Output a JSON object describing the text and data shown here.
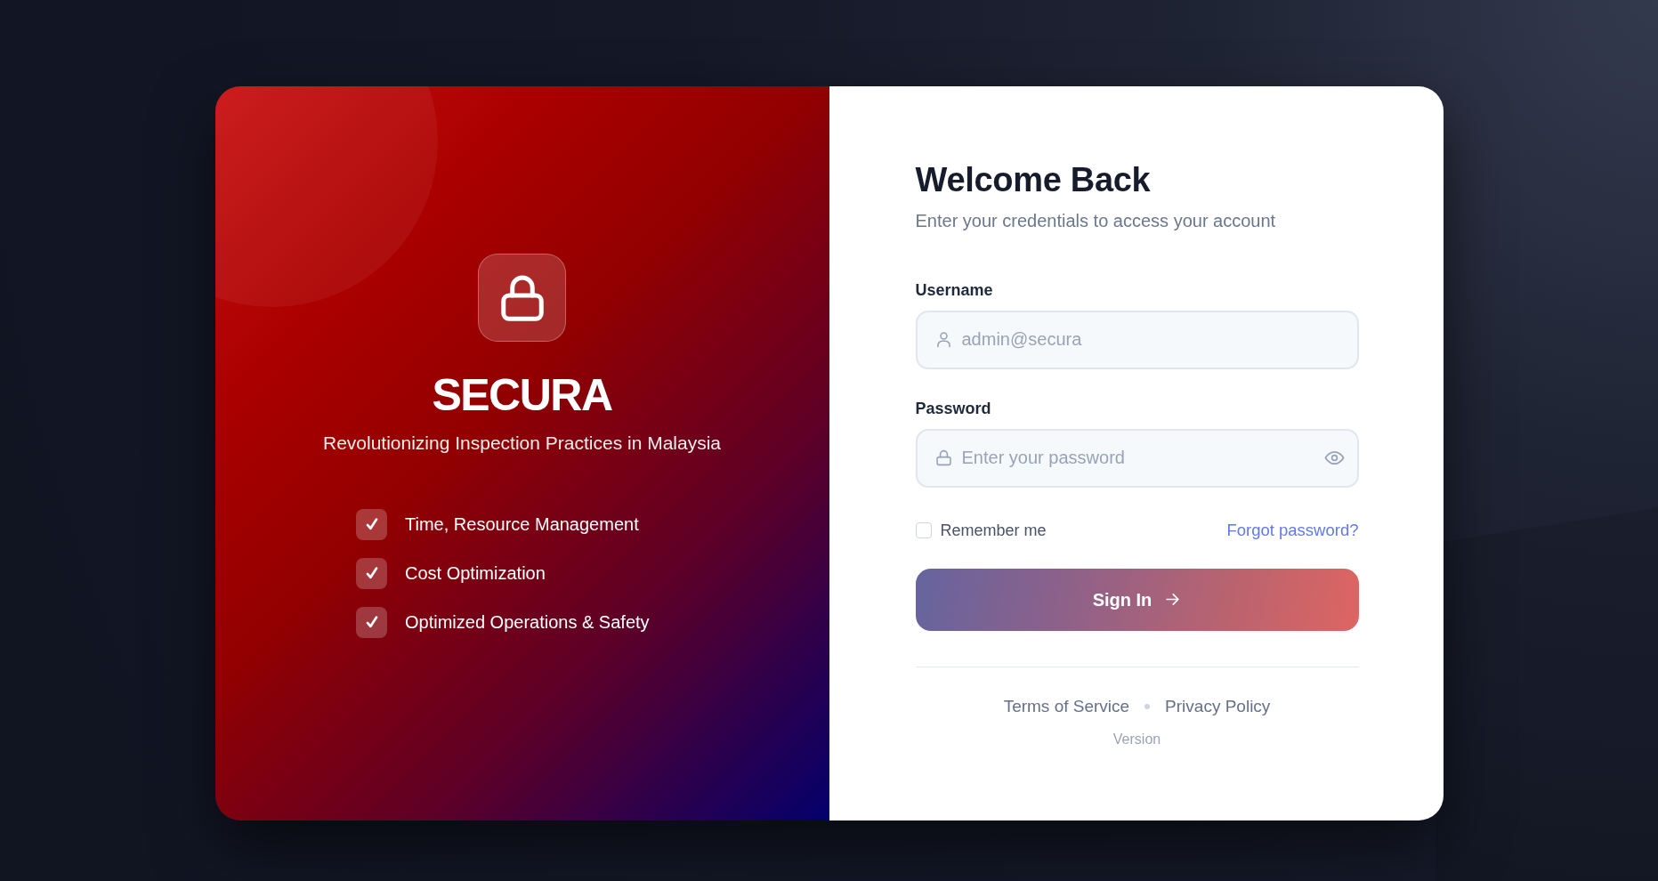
{
  "brand_panel": {
    "title": "SECURA",
    "tagline": "Revolutionizing Inspection Practices in Malaysia",
    "features": [
      "Time, Resource Management",
      "Cost Optimization",
      "Optimized Operations & Safety"
    ]
  },
  "login_form": {
    "title": "Welcome Back",
    "subtitle": "Enter your credentials to access your account",
    "fields": [
      {
        "kind": "username",
        "label": "Username",
        "placeholder": "admin@secura"
      },
      {
        "kind": "password",
        "label": "Password",
        "placeholder": "Enter your password"
      }
    ],
    "remember_me": {
      "label": "Remember me",
      "checked": false
    },
    "forgot_password": "Forgot password?",
    "submit_button": "Sign In",
    "footer_links": [
      "Terms of Service",
      "Privacy Policy"
    ],
    "version": "Version"
  }
}
